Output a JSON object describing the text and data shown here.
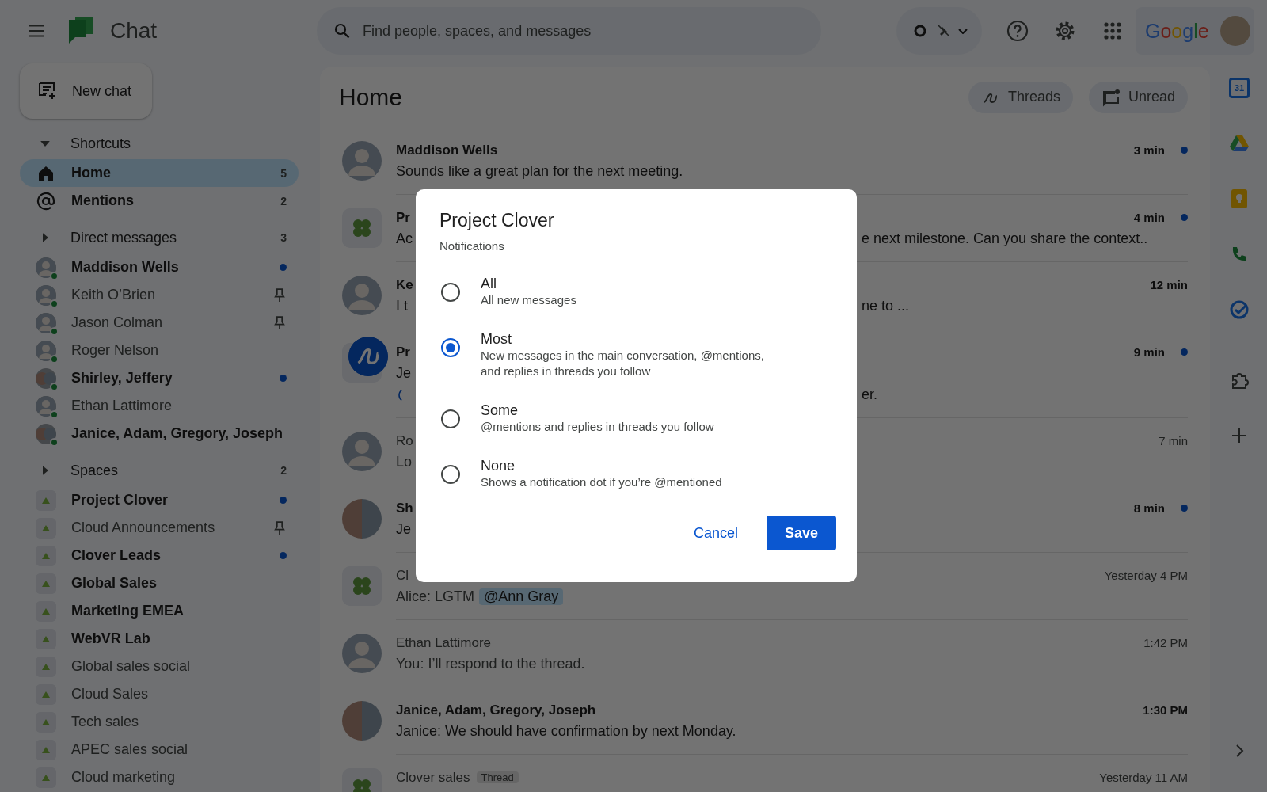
{
  "app": {
    "title": "Chat"
  },
  "search": {
    "placeholder": "Find people, spaces, and messages"
  },
  "account": {
    "logo_text": "Google"
  },
  "new_chat": {
    "label": "New chat"
  },
  "sidebar": {
    "sections": [
      {
        "title": "Shortcuts",
        "expanded": true,
        "kind": "shortcut",
        "items": [
          {
            "label": "Home",
            "count": "5",
            "selected": true,
            "unread": true
          },
          {
            "label": "Mentions",
            "count": "2",
            "selected": false,
            "unread": true
          }
        ]
      },
      {
        "title": "Direct messages",
        "expanded": false,
        "count": "3",
        "kind": "dm",
        "items": [
          {
            "label": "Maddison Wells",
            "kind": "person",
            "online": true,
            "unread": true,
            "unread_dot": true,
            "pinned": false,
            "selected": false
          },
          {
            "label": "Keith O’Brien",
            "kind": "person",
            "online": true,
            "unread": false,
            "unread_dot": false,
            "pinned": true,
            "selected": false
          },
          {
            "label": "Jason Colman",
            "kind": "person",
            "online": true,
            "unread": false,
            "unread_dot": false,
            "pinned": true,
            "selected": false
          },
          {
            "label": "Roger Nelson",
            "kind": "person",
            "online": true,
            "unread": false,
            "unread_dot": false,
            "pinned": false,
            "selected": false
          },
          {
            "label": "Shirley, Jeffery",
            "kind": "group",
            "online": true,
            "unread": true,
            "unread_dot": true,
            "pinned": false,
            "selected": false
          },
          {
            "label": "Ethan Lattimore",
            "kind": "person",
            "online": true,
            "unread": false,
            "unread_dot": false,
            "pinned": false,
            "selected": false
          },
          {
            "label": "Janice, Adam, Gregory, Joseph",
            "kind": "group",
            "online": true,
            "unread": true,
            "unread_dot": false,
            "pinned": false,
            "selected": false
          }
        ]
      },
      {
        "title": "Spaces",
        "expanded": false,
        "count": "2",
        "kind": "space",
        "items": [
          {
            "label": "Project Clover",
            "unread": true,
            "unread_dot": true,
            "pinned": false,
            "selected": false
          },
          {
            "label": "Cloud Announcements",
            "unread": false,
            "unread_dot": false,
            "pinned": true,
            "selected": false
          },
          {
            "label": "Clover Leads",
            "unread": true,
            "unread_dot": true,
            "pinned": false,
            "selected": false
          },
          {
            "label": "Global Sales",
            "unread": true,
            "unread_dot": false,
            "pinned": false,
            "selected": false
          },
          {
            "label": "Marketing EMEA",
            "unread": true,
            "unread_dot": false,
            "pinned": false,
            "selected": false
          },
          {
            "label": "WebVR Lab",
            "unread": true,
            "unread_dot": false,
            "pinned": false,
            "selected": false
          },
          {
            "label": "Global sales social",
            "unread": false,
            "unread_dot": false,
            "pinned": false,
            "selected": false
          },
          {
            "label": "Cloud Sales",
            "unread": false,
            "unread_dot": false,
            "pinned": false,
            "selected": false
          },
          {
            "label": "Tech sales",
            "unread": false,
            "unread_dot": false,
            "pinned": false,
            "selected": false
          },
          {
            "label": "APEC sales social",
            "unread": false,
            "unread_dot": false,
            "pinned": false,
            "selected": false
          },
          {
            "label": "Cloud marketing",
            "unread": false,
            "unread_dot": false,
            "pinned": false,
            "selected": false
          }
        ]
      }
    ]
  },
  "main": {
    "title": "Home",
    "filters": [
      {
        "label": "Threads"
      },
      {
        "label": "Unread"
      }
    ],
    "messages": [
      {
        "kind": "person",
        "name": "Maddison Wells",
        "text": "Sounds like a great plan for the next meeting.",
        "time": "3 min",
        "unread": true,
        "dot": true
      },
      {
        "kind": "space",
        "name": "Pr",
        "text": "Ac",
        "text_right": "e next milestone. Can you share the context..",
        "time": "4 min",
        "unread": true,
        "dot": true
      },
      {
        "kind": "person",
        "name": "Ke",
        "text": "I t",
        "text_right": "ne to ...",
        "time": "12 min",
        "unread": true,
        "dot": false
      },
      {
        "kind": "space",
        "badge": true,
        "name": "Pr",
        "text": "Je",
        "line3_right": "er.",
        "time": "9 min",
        "unread": true,
        "dot": true
      },
      {
        "kind": "person",
        "name": "Ro",
        "text": "Lo",
        "time": "7 min",
        "unread": false,
        "dot": false
      },
      {
        "kind": "group",
        "name": "Sh",
        "text": "Je",
        "time": "8 min",
        "unread": true,
        "dot": true
      },
      {
        "kind": "space",
        "name": "Cl",
        "text": "Alice: LGTM",
        "mention": "@Ann Gray",
        "time": "Yesterday 4 PM",
        "unread": false,
        "dot": false
      },
      {
        "kind": "person",
        "name": "Ethan Lattimore",
        "text": "You: I’ll respond to the thread.",
        "time": "1:42 PM",
        "unread": false,
        "dot": false
      },
      {
        "kind": "group",
        "name": "Janice, Adam, Gregory, Joseph",
        "text": "Janice: We should have confirmation by next Monday.",
        "time": "1:30 PM",
        "unread": true,
        "dot": false
      },
      {
        "kind": "space",
        "name": "Clover sales",
        "tag": "Thread",
        "time": "Yesterday 11 AM",
        "unread": false,
        "dot": false
      }
    ]
  },
  "rail": {
    "calendar_day": "31"
  },
  "dialog": {
    "title": "Project Clover",
    "subtitle": "Notifications",
    "options": [
      {
        "label": "All",
        "description": "All new messages",
        "selected": false
      },
      {
        "label": "Most",
        "description": "New messages in the main conversation, @mentions, and replies in threads you follow",
        "selected": true
      },
      {
        "label": "Some",
        "description": "@mentions and replies in threads you follow",
        "selected": false
      },
      {
        "label": "None",
        "description": "Shows a notification dot if you’re @mentioned",
        "selected": false
      }
    ],
    "buttons": [
      {
        "label": "Cancel",
        "kind": "text"
      },
      {
        "label": "Save",
        "kind": "filled"
      }
    ]
  }
}
